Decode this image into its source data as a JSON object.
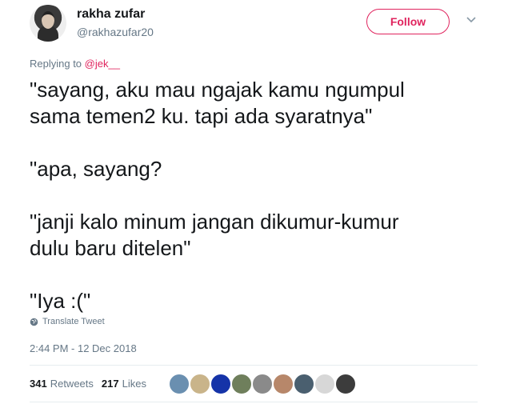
{
  "user": {
    "name": "rakha zufar",
    "handle": "@rakhazufar20"
  },
  "follow_label": "Follow",
  "reply": {
    "prefix": "Replying to",
    "to": "@jek__"
  },
  "tweet_lines": [
    "\"sayang, aku mau ngajak kamu ngumpul",
    "sama temen2 ku. tapi ada syaratnya\"",
    "\"apa, sayang?",
    "\"janji kalo minum jangan dikumur-kumur",
    "dulu baru ditelen\"",
    "\"Iya :(\""
  ],
  "translate_label": "Translate Tweet",
  "timestamp": "2:44 PM - 12 Dec 2018",
  "stats": {
    "retweets_count": "341",
    "retweets_label": "Retweets",
    "likes_count": "217",
    "likes_label": "Likes"
  },
  "colors": {
    "accent": "#e0245e",
    "secondary_text": "#657786",
    "divider": "#e6ecf0"
  },
  "liker_avatars": [
    "#6a8fb0",
    "#c9b48a",
    "#1533a8",
    "#6f7f5c",
    "#8a8a8a",
    "#b7876a",
    "#4a5f6f",
    "#d7d7d7",
    "#3c3c3c"
  ]
}
